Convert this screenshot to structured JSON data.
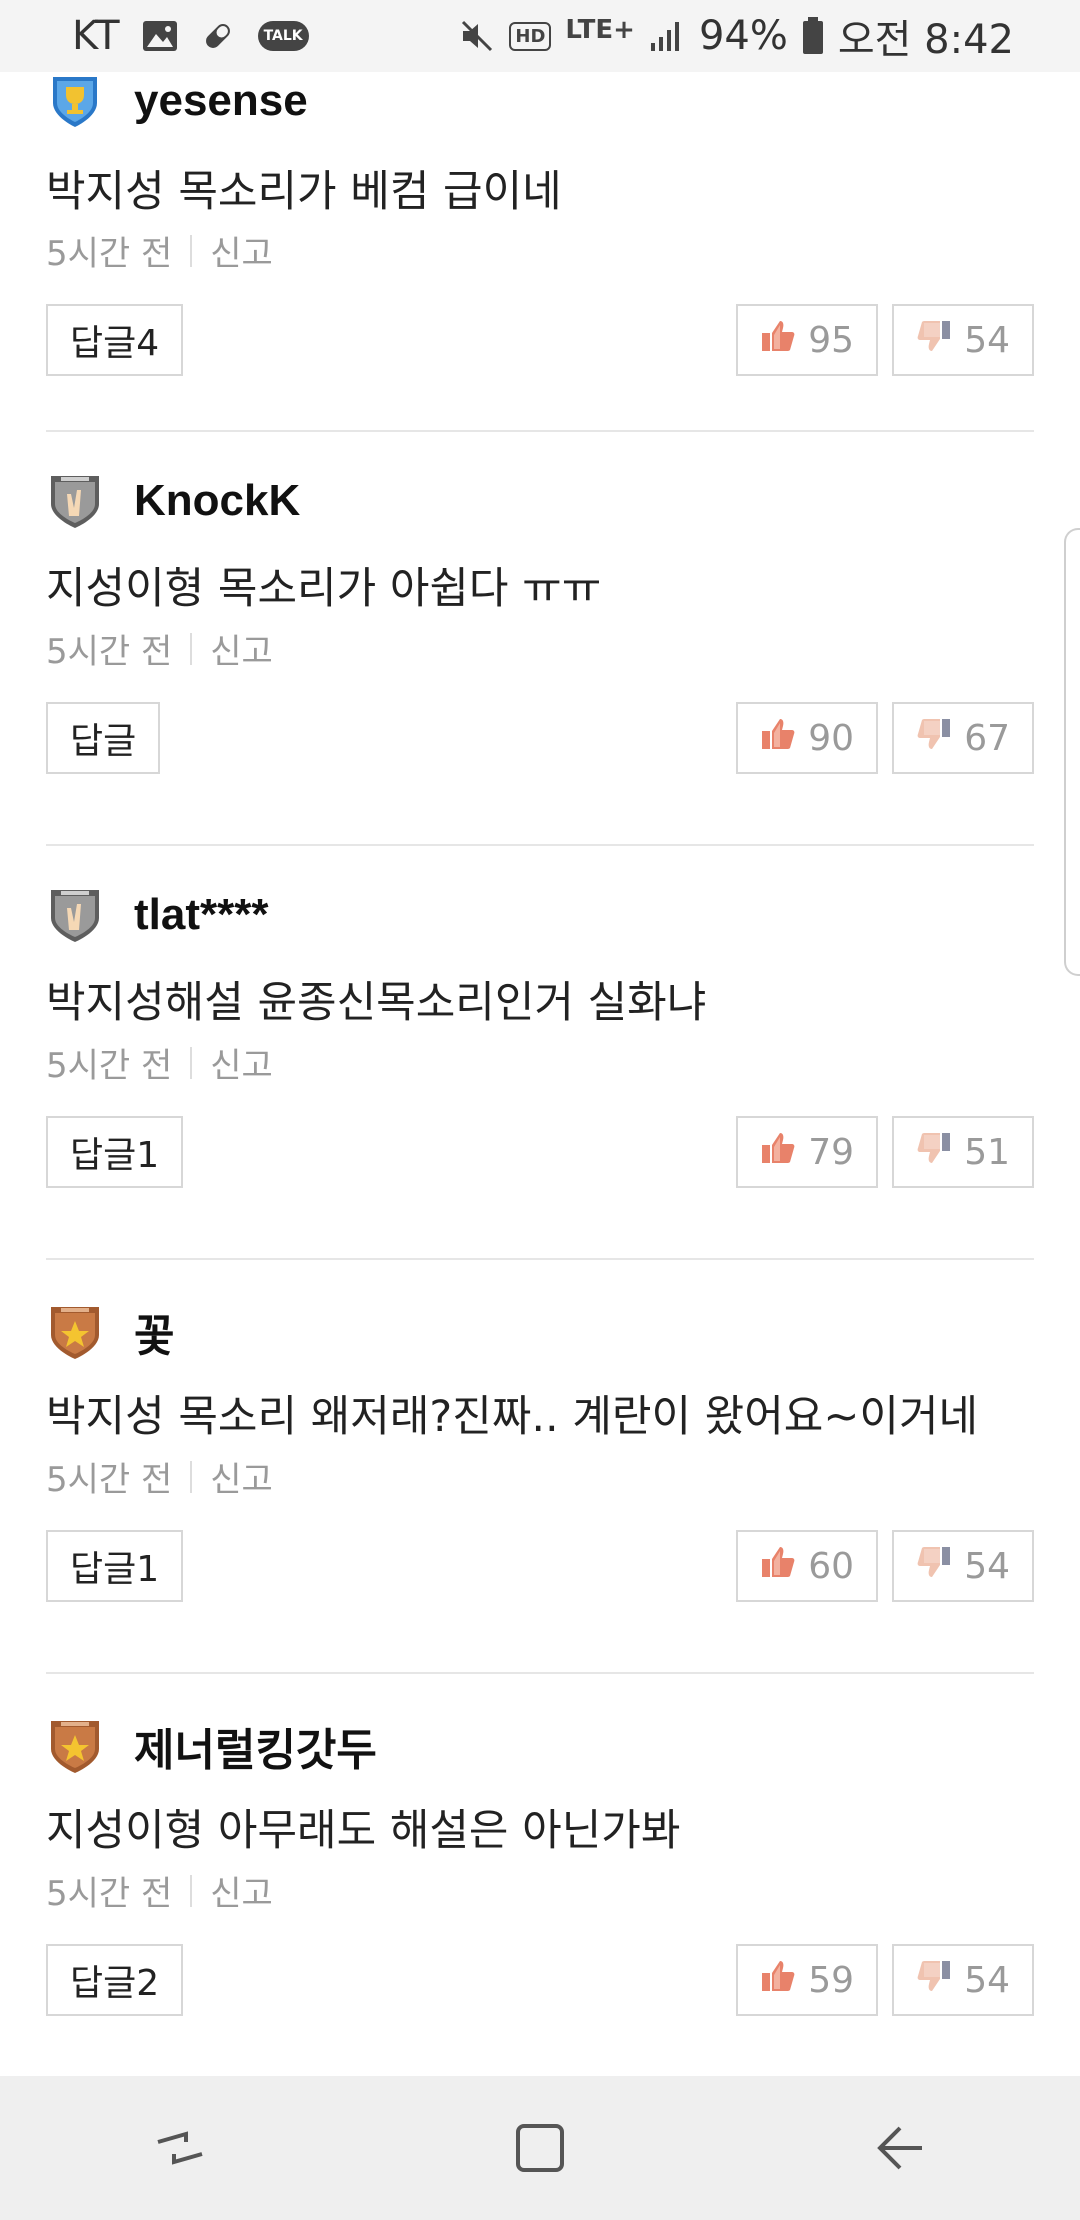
{
  "status_bar": {
    "carrier": "KT",
    "talk_label": "TALK",
    "hd_label": "HD",
    "network": "LTE+",
    "battery": "94%",
    "time": "오전 8:42"
  },
  "comments": [
    {
      "username": "yesense",
      "badge": "pro-trophy-icon",
      "text": "박지성 목소리가 베컴 급이네",
      "time": "5시간 전",
      "report": "신고",
      "reply": "답글4",
      "likes": "95",
      "dislikes": "54"
    },
    {
      "username": "KnockK",
      "badge": "rookie-victory-icon",
      "text": "지성이형 목소리가 아쉽다 ㅠㅠ",
      "time": "5시간 전",
      "report": "신고",
      "reply": "답글",
      "likes": "90",
      "dislikes": "67"
    },
    {
      "username": "tlat****",
      "badge": "rookie-victory-icon",
      "text": "박지성해설 윤종신목소리인거 실화냐",
      "time": "5시간 전",
      "report": "신고",
      "reply": "답글1",
      "likes": "79",
      "dislikes": "51"
    },
    {
      "username": "꽃",
      "badge": "senior-star-icon",
      "text": "박지성 목소리 왜저래?진짜.. 계란이 왔어요~이거네",
      "time": "5시간 전",
      "report": "신고",
      "reply": "답글1",
      "likes": "60",
      "dislikes": "54"
    },
    {
      "username": "제너럴킹갓두",
      "badge": "senior-star-icon",
      "text": "지성이형 아무래도 해설은 아닌가봐",
      "time": "5시간 전",
      "report": "신고",
      "reply": "답글2",
      "likes": "59",
      "dislikes": "54"
    }
  ],
  "colors": {
    "thumb_up": "#e8826a",
    "thumb_down": "#8a8fa3",
    "divider": "#e6e6e6"
  }
}
